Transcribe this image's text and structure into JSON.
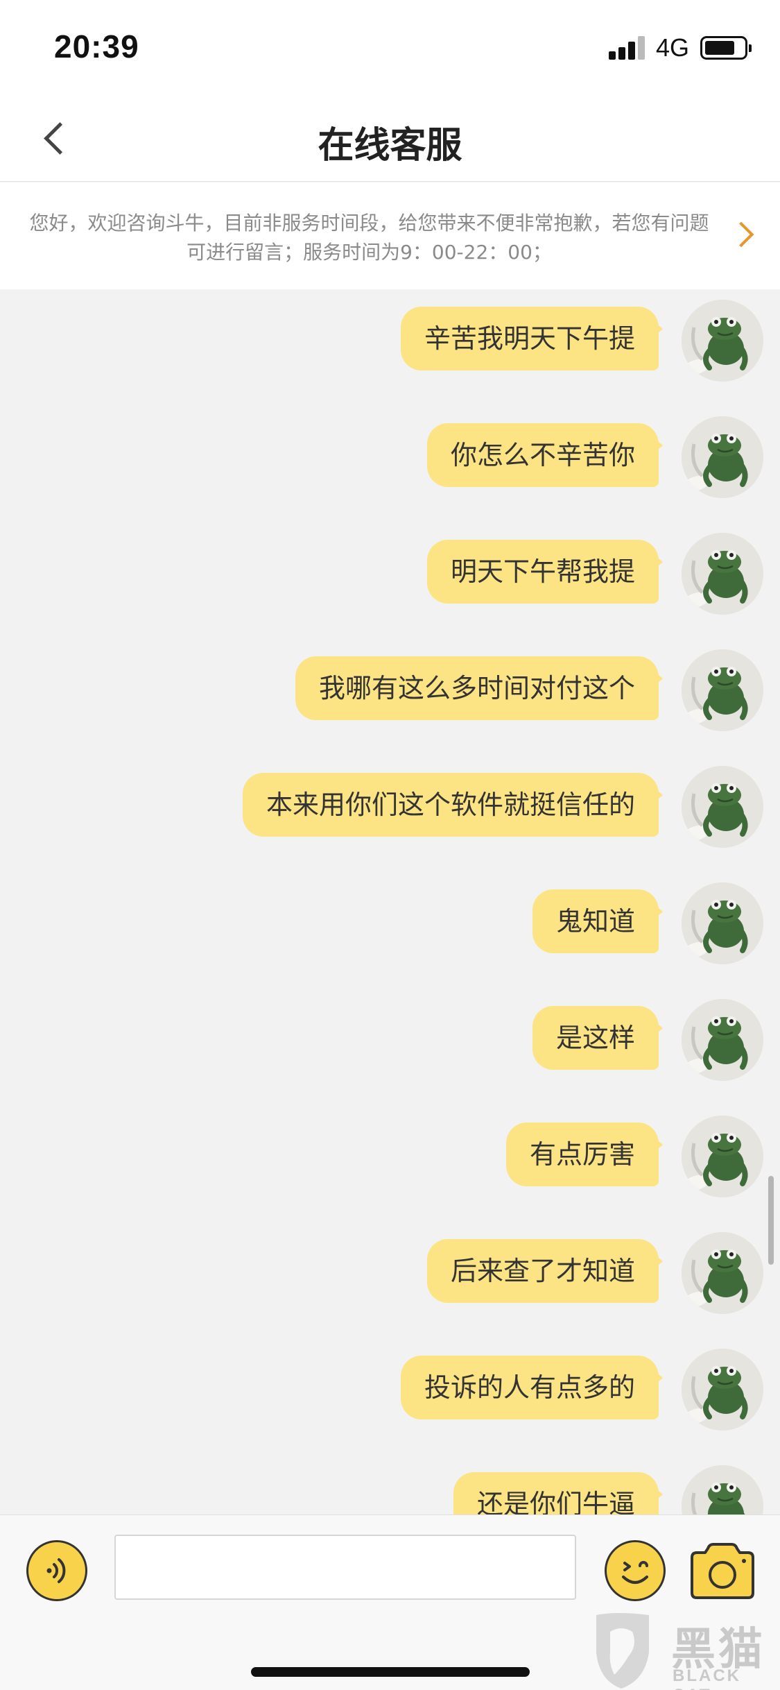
{
  "status_bar": {
    "time": "20:39",
    "network": "4G"
  },
  "nav": {
    "title": "在线客服"
  },
  "notice": {
    "text": "您好，欢迎咨询斗牛，目前非服务时间段，给您带来不便非常抱歉，若您有问题可进行留言；服务时间为9：00-22：00；"
  },
  "messages": [
    {
      "text": "辛苦我明天下午提",
      "sender": "me"
    },
    {
      "text": "你怎么不辛苦你",
      "sender": "me"
    },
    {
      "text": "明天下午帮我提",
      "sender": "me"
    },
    {
      "text": "我哪有这么多时间对付这个",
      "sender": "me"
    },
    {
      "text": "本来用你们这个软件就挺信任的",
      "sender": "me"
    },
    {
      "text": "鬼知道",
      "sender": "me"
    },
    {
      "text": "是这样",
      "sender": "me"
    },
    {
      "text": "有点厉害",
      "sender": "me"
    },
    {
      "text": "后来查了才知道",
      "sender": "me"
    },
    {
      "text": "投诉的人有点多的",
      "sender": "me"
    },
    {
      "text": "还是你们牛逼",
      "sender": "me"
    }
  ],
  "input": {
    "value": "",
    "placeholder": ""
  },
  "icons": {
    "voice": "voice-icon",
    "emoji": "emoji-icon",
    "camera": "camera-icon",
    "avatar": "frog-plush-avatar"
  },
  "colors": {
    "bubble": "#fce384",
    "accent": "#f8d24a",
    "chevron": "#e8952a"
  },
  "watermark": {
    "text": "黑猫",
    "sub": "BLACK CAT"
  }
}
